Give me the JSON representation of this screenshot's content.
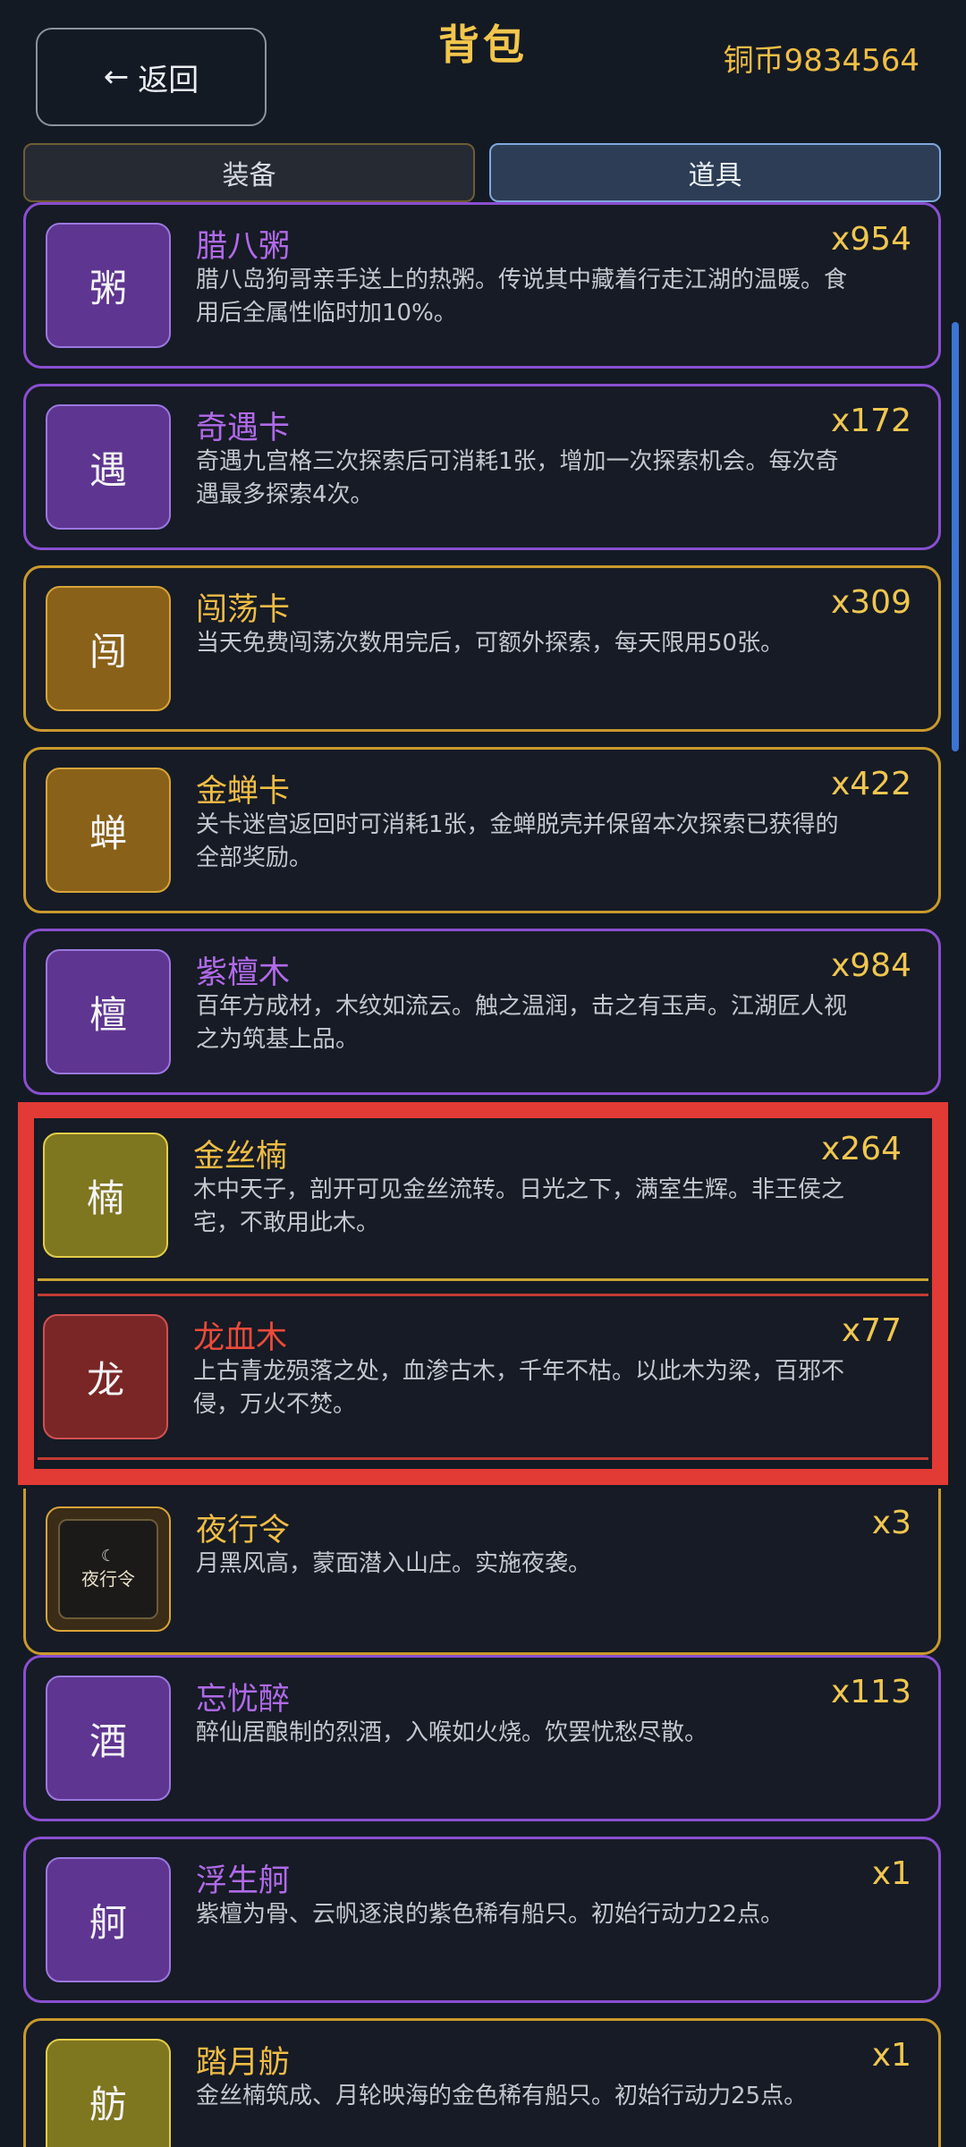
{
  "header": {
    "back_label": "返回",
    "title": "背包",
    "coins": "铜币9834564"
  },
  "tabs": [
    {
      "label": "装备",
      "active": false
    },
    {
      "label": "道具",
      "active": true
    }
  ],
  "items": [
    {
      "icon_char": "粥",
      "name": "腊八粥",
      "count": "x954",
      "desc": "腊八岛狗哥亲手送上的热粥。传说其中藏着行走江湖的温暖。食用后全属性临时加10%。",
      "rarity": "purple"
    },
    {
      "icon_char": "遇",
      "name": "奇遇卡",
      "count": "x172",
      "desc": "奇遇九宫格三次探索后可消耗1张，增加一次探索机会。每次奇遇最多探索4次。",
      "rarity": "purple"
    },
    {
      "icon_char": "闯",
      "name": "闯荡卡",
      "count": "x309",
      "desc": "当天免费闯荡次数用完后，可额外探索，每天限用50张。",
      "rarity": "gold"
    },
    {
      "icon_char": "蝉",
      "name": "金蝉卡",
      "count": "x422",
      "desc": "关卡迷宫返回时可消耗1张，金蝉脱壳并保留本次探索已获得的全部奖励。",
      "rarity": "gold"
    },
    {
      "icon_char": "檀",
      "name": "紫檀木",
      "count": "x984",
      "desc": "百年方成材，木纹如流云。触之温润，击之有玉声。江湖匠人视之为筑基上品。",
      "rarity": "purple"
    },
    {
      "icon_char": "楠",
      "name": "金丝楠",
      "count": "x264",
      "desc": "木中天子，剖开可见金丝流转。日光之下，满室生辉。非王侯之宅，不敢用此木。",
      "rarity": "gold"
    },
    {
      "icon_char": "龙",
      "name": "龙血木",
      "count": "x77",
      "desc": "上古青龙殒落之处，血渗古木，千年不枯。以此木为梁，百邪不侵，万火不焚。",
      "rarity": "red"
    },
    {
      "icon_char": "夜行令",
      "name": "夜行令",
      "count": "x3",
      "desc": "月黑风高，蒙面潜入山庄。实施夜袭。",
      "rarity": "gold"
    },
    {
      "icon_char": "酒",
      "name": "忘忧醉",
      "count": "x113",
      "desc": "醉仙居酿制的烈酒，入喉如火烧。饮罢忧愁尽散。",
      "rarity": "purple"
    },
    {
      "icon_char": "舸",
      "name": "浮生舸",
      "count": "x1",
      "desc": "紫檀为骨、云帆逐浪的紫色稀有船只。初始行动力22点。",
      "rarity": "purple"
    },
    {
      "icon_char": "舫",
      "name": "踏月舫",
      "count": "x1",
      "desc": "金丝楠筑成、月轮映海的金色稀有船只。初始行动力25点。",
      "rarity": "gold"
    }
  ],
  "colors": {
    "background": "#141a24",
    "purple_rarity": "#8a4fd0",
    "gold_rarity": "#c99a2c",
    "red_rarity": "#ee4a3a",
    "highlight_frame": "#e23a35",
    "coin_text": "#f0be45"
  }
}
